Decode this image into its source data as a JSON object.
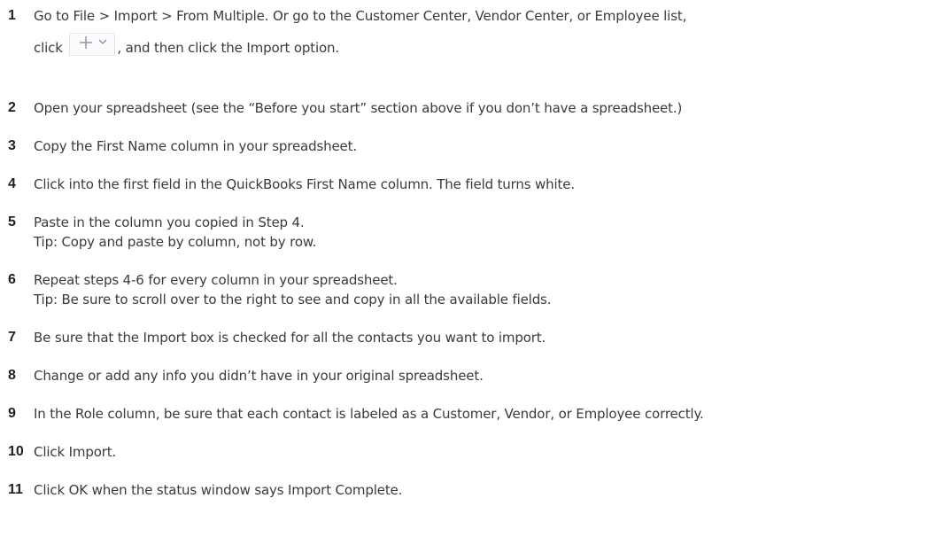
{
  "steps": [
    {
      "number": "1",
      "text_a": "Go to File > Import > From Multiple. Or go to the Customer Center, Vendor Center, or Employee list,",
      "text_b_before": "click",
      "button_icons": [
        "plus-icon",
        "chevron-down-icon"
      ],
      "text_b_after": ", and then click the Import option."
    },
    {
      "number": "2",
      "text": "Open your spreadsheet (see the “Before you start” section above if you don’t have a spreadsheet.)"
    },
    {
      "number": "3",
      "text": "Copy the First Name column in your spreadsheet."
    },
    {
      "number": "4",
      "text": "Click into the first field in the QuickBooks First Name column. The field turns white."
    },
    {
      "number": "5",
      "text": "Paste in the column you copied in Step 4.",
      "tip": "Tip: Copy and paste by column, not by row."
    },
    {
      "number": "6",
      "text": "Repeat steps 4-6 for every column in your spreadsheet.",
      "tip": "Tip: Be sure to scroll over to the right to see and copy in all the available fields."
    },
    {
      "number": "7",
      "text": "Be sure that the Import box is checked for all the contacts you want to import."
    },
    {
      "number": "8",
      "text": "Change or add any info you didn’t have in your original spreadsheet."
    },
    {
      "number": "9",
      "text": "In the Role column, be sure that each contact is labeled as a Customer, Vendor, or Employee correctly."
    },
    {
      "number": "10",
      "text": "Click Import."
    },
    {
      "number": "11",
      "text": "Click OK when the status window says Import Complete."
    }
  ],
  "colors": {
    "text": "#393a3d",
    "number": "#1f1f1f",
    "button_border": "#e6e8eb",
    "button_icon": "#8d9096"
  }
}
